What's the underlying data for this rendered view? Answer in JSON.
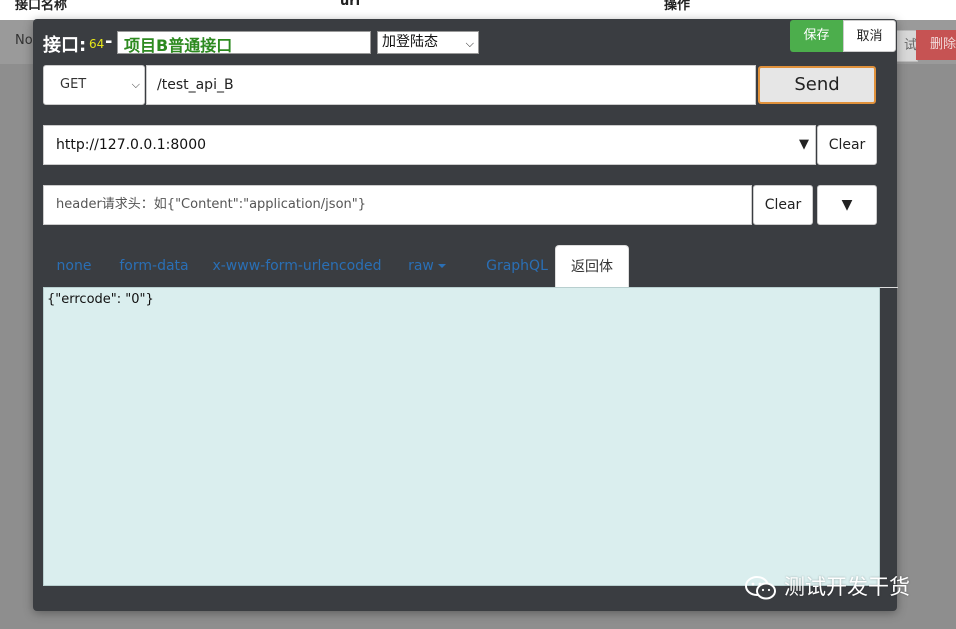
{
  "background": {
    "columns": [
      "接口名称",
      "url",
      "操作"
    ],
    "row_text": "No",
    "test_button": "试",
    "delete_button": "删除"
  },
  "modal": {
    "title_label": "接口:",
    "api_id": "64",
    "title_dash": "-",
    "api_name": "项目B普通接口",
    "status_selected": "加登陆态",
    "save_label": "保存",
    "cancel_label": "取消",
    "method": "GET",
    "path": "/test_api_B",
    "send_label": "Send",
    "host": "http://127.0.0.1:8000",
    "clear_label": "Clear",
    "header_placeholder": "header请求头：如{\"Content\":\"application/json\"}",
    "toggle_label": "▼",
    "tabs": [
      {
        "label": "none"
      },
      {
        "label": "form-data"
      },
      {
        "label": "x-www-form-urlencoded"
      },
      {
        "label": "raw"
      },
      {
        "label": "GraphQL"
      },
      {
        "label": "返回体"
      }
    ],
    "active_tab": "返回体",
    "response_body": "{\"errcode\": \"0\"}"
  },
  "watermark": "测试开发干货",
  "colors": {
    "modal_bg": "#3a3d41",
    "save_green": "#4cae4c",
    "send_border": "#e0913b",
    "name_text": "#2d8a20",
    "id_text": "#e6e619",
    "body_bg": "#daeeee",
    "tab_link": "#2a6fb5"
  }
}
